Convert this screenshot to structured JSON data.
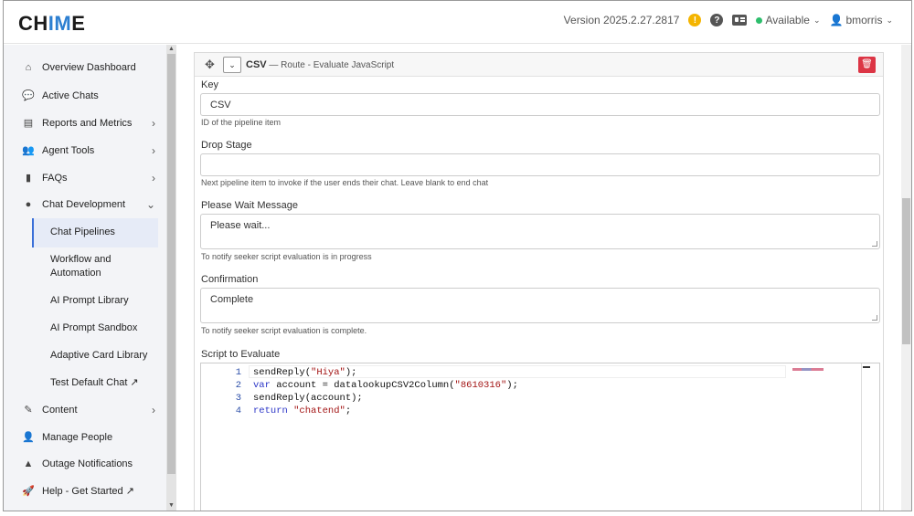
{
  "header": {
    "logo_left": "CH",
    "logo_mid": "IM",
    "logo_right": "E",
    "version": "Version 2025.2.27.2817",
    "warning_glyph": "!",
    "help_glyph": "?",
    "status": "Available",
    "status_color": "#2dbe6c",
    "username": "bmorris"
  },
  "sidebar": {
    "items": [
      {
        "label": "Overview Dashboard",
        "icon": "home-icon",
        "glyph": "⌂"
      },
      {
        "label": "Active Chats",
        "icon": "chat-bubbles-icon",
        "glyph": "💬"
      },
      {
        "label": "Reports and Metrics",
        "icon": "chart-icon",
        "glyph": "▤"
      },
      {
        "label": "Agent Tools",
        "icon": "users-icon",
        "glyph": "👥"
      },
      {
        "label": "FAQs",
        "icon": "book-icon",
        "glyph": "▮"
      },
      {
        "label": "Chat Development",
        "icon": "comment-icon",
        "glyph": "●"
      },
      {
        "label": "Content",
        "icon": "edit-icon",
        "glyph": "✎"
      },
      {
        "label": "Manage People",
        "icon": "person-icon",
        "glyph": "👤"
      },
      {
        "label": "Outage Notifications",
        "icon": "alert-triangle-icon",
        "glyph": "▲"
      },
      {
        "label": "Help - Get Started ↗",
        "icon": "rocket-icon",
        "glyph": "🚀"
      }
    ],
    "subitems": [
      "Chat Pipelines",
      "Workflow and Automation",
      "AI Prompt Library",
      "AI Prompt Sandbox",
      "Adaptive Card Library",
      "Test Default Chat ↗"
    ]
  },
  "panel": {
    "title": "CSV",
    "subtitle": " — Route - Evaluate JavaScript",
    "fields": {
      "key_label": "Key",
      "key_value": "CSV",
      "key_help": "ID of the pipeline item",
      "drop_label": "Drop Stage",
      "drop_value": "",
      "drop_help": "Next pipeline item to invoke if the user ends their chat. Leave blank to end chat",
      "wait_label": "Please Wait Message",
      "wait_value": "Please wait...",
      "wait_help": "To notify seeker script evaluation is in progress",
      "confirm_label": "Confirmation",
      "confirm_value": "Complete",
      "confirm_help": "To notify seeker script evaluation is complete.",
      "script_label": "Script to Evaluate"
    },
    "code_lines": [
      {
        "n": "1",
        "a": "sendReply(",
        "s": "\"Hiya\"",
        "b": ");"
      },
      {
        "n": "2",
        "k": "var",
        "a": " account = datalookupCSV2Column(",
        "s": "\"8610316\"",
        "b": ");"
      },
      {
        "n": "3",
        "a": "sendReply(account);"
      },
      {
        "n": "4",
        "k": "return",
        "s": " \"chatend\"",
        "b": ";"
      }
    ]
  }
}
